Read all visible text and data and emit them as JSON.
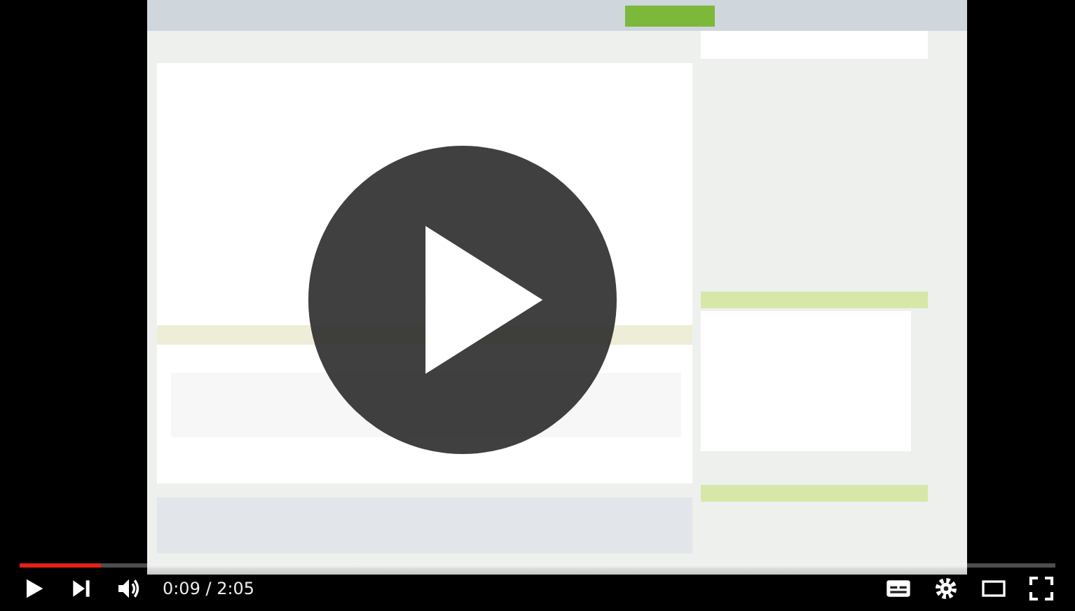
{
  "player": {
    "kind": "picture",
    "progress": {
      "level": 0.078
    },
    "time": "0:09 / 2:05"
  }
}
